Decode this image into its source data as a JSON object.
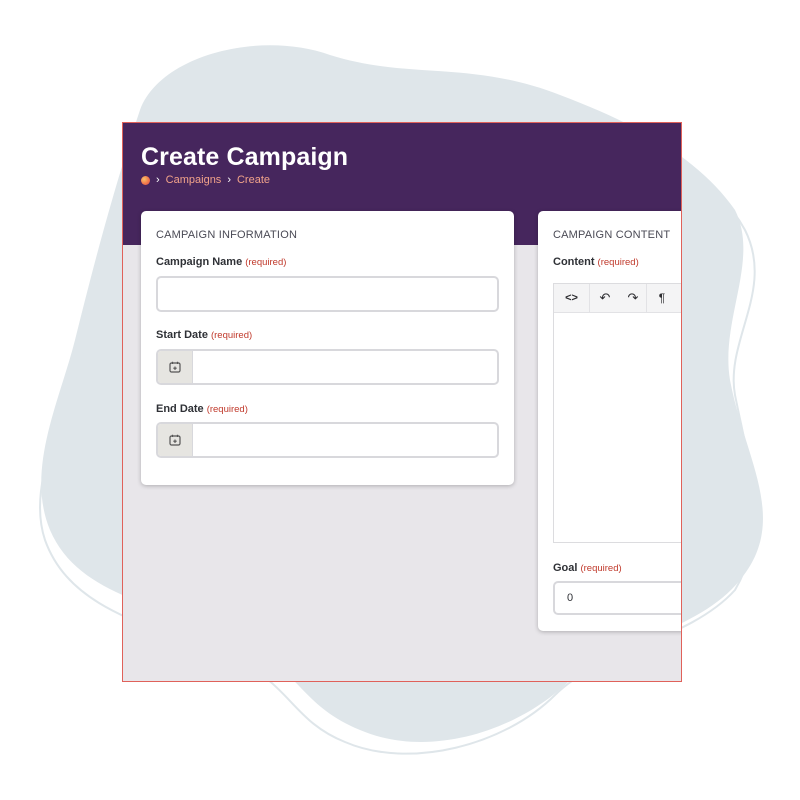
{
  "page": {
    "title": "Create Campaign",
    "breadcrumb": {
      "home_icon": "home-logo-icon",
      "items": [
        "Campaigns",
        "Create"
      ],
      "separator": "›"
    }
  },
  "campaign_information": {
    "heading": "CAMPAIGN INFORMATION",
    "required_text": "(required)",
    "name": {
      "label": "Campaign Name",
      "value": ""
    },
    "start_date": {
      "label": "Start Date",
      "value": "",
      "icon": "calendar-icon"
    },
    "end_date": {
      "label": "End Date",
      "value": "",
      "icon": "calendar-icon"
    }
  },
  "campaign_content": {
    "heading": "CAMPAIGN CONTENT",
    "required_text": "(required)",
    "content": {
      "label": "Content",
      "value": "",
      "toolbar": {
        "code_view": "<>",
        "undo": "↶",
        "redo": "↷",
        "paragraph": "¶"
      }
    },
    "goal": {
      "label": "Goal",
      "value": "0"
    }
  },
  "colors": {
    "header": "#46265d",
    "breadcrumb_link": "#f2a38a",
    "required": "#c0392b",
    "page_background": "#e8e6ea",
    "window_border": "#e0615a"
  }
}
